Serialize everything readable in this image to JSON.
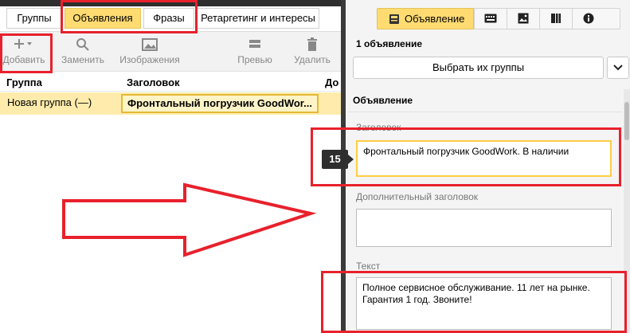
{
  "left": {
    "tabs": [
      {
        "label": "Группы",
        "active": false
      },
      {
        "label": "Объявления",
        "active": true
      },
      {
        "label": "Фразы",
        "active": false
      },
      {
        "label": "Ретаргетинг и интересы",
        "active": false
      }
    ],
    "toolbar": {
      "add": "Добавить",
      "replace": "Заменить",
      "images": "Изображения",
      "preview": "Превью",
      "delete": "Удалить"
    },
    "grid": {
      "columns": [
        "Группа",
        "Заголовок",
        "До"
      ],
      "rows": [
        {
          "group": "Новая группа (—)",
          "title": "Фронтальный погрузчик GoodWor..."
        }
      ]
    }
  },
  "right": {
    "tabs": [
      {
        "label": "Объявление",
        "icon": "ad-icon",
        "active": true
      },
      {
        "label": "",
        "icon": "keyboard-icon",
        "active": false
      },
      {
        "label": "",
        "icon": "image-icon",
        "active": false
      },
      {
        "label": "",
        "icon": "video-icon",
        "active": false
      },
      {
        "label": "",
        "icon": "info-icon",
        "active": false
      }
    ],
    "count_label": "1 объявление",
    "choose_button": "Выбрать их группы",
    "section_title": "Объявление",
    "fields": {
      "title_label": "Заголовок",
      "title_value": "Фронтальный погрузчик GoodWork. В наличии",
      "title_counter": "15",
      "extra_title_label": "Дополнительный заголовок",
      "extra_title_value": "",
      "text_label": "Текст",
      "text_value": "Полное сервисное обслуживание. 11 лет на рынке. Гарантия 1 год. Звоните!"
    }
  },
  "colors": {
    "accent": "#ffdb71",
    "selected_row": "#ffecac",
    "annotation": "#e8212c"
  }
}
